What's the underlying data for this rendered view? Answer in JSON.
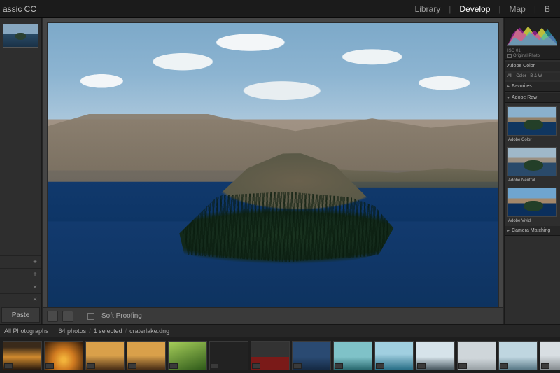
{
  "header": {
    "app_title": "assic CC",
    "nav": {
      "library": "Library",
      "develop": "Develop",
      "map": "Map",
      "book": "B"
    }
  },
  "left": {
    "paste": "Paste",
    "row_icons": [
      "+",
      "+",
      "×",
      "×"
    ]
  },
  "toolbar": {
    "soft_proofing": "Soft Proofing"
  },
  "right": {
    "iso_label": "ISO 01",
    "original_photo": "Original Photo",
    "profile_section": "Adobe Color",
    "filters": {
      "all": "All",
      "color": "Color",
      "bw": "B & W"
    },
    "favorites": "Favorites",
    "adobe_raw": "Adobe Raw",
    "presets": [
      {
        "name": "Adobe Color"
      },
      {
        "name": "Adobe Neutral"
      },
      {
        "name": "Adobe Vivid"
      }
    ],
    "camera_matching": "Camera Matching"
  },
  "status": {
    "collection": "All Photographs",
    "count": "64 photos",
    "selection": "1 selected",
    "filename": "craterlake.dng"
  },
  "filmstrip": {
    "thumbs": [
      "fs-sunset",
      "fs-sunset2",
      "fs-warm",
      "fs-warm",
      "fs-green",
      "fs-dark",
      "fs-red",
      "fs-bluewide",
      "fs-teal",
      "fs-aqua",
      "fs-mtn",
      "fs-cloud",
      "fs-ice",
      "fs-snow",
      "fs-sky",
      "fs-yellow",
      "fs-waves",
      "fs-tall",
      "fs-tall2"
    ],
    "selected_index": 14
  }
}
